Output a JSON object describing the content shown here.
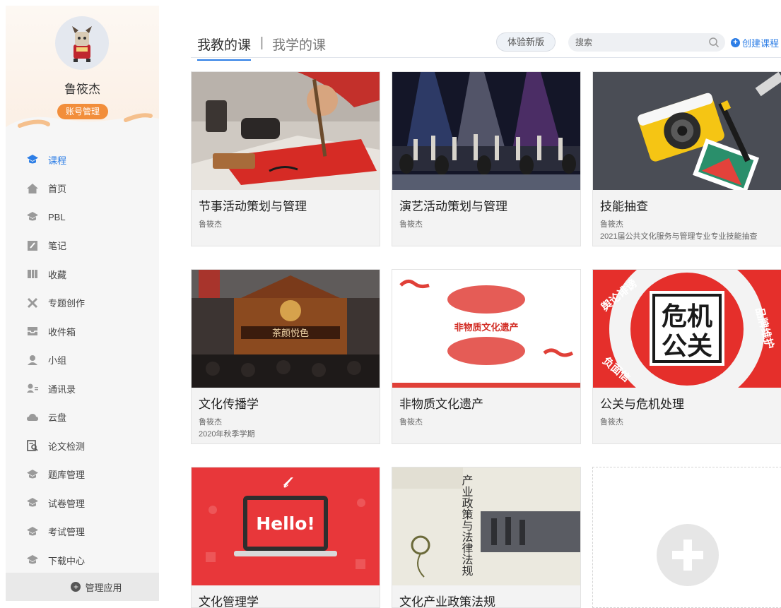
{
  "sidebar": {
    "user_name": "鲁筱杰",
    "account_button": "账号管理",
    "nav": [
      {
        "label": "课程",
        "icon": "course-icon",
        "active": true
      },
      {
        "label": "首页",
        "icon": "home-icon"
      },
      {
        "label": "PBL",
        "icon": "pbl-icon"
      },
      {
        "label": "笔记",
        "icon": "notes-icon"
      },
      {
        "label": "收藏",
        "icon": "favorites-icon"
      },
      {
        "label": "专题创作",
        "icon": "topic-create-icon"
      },
      {
        "label": "收件箱",
        "icon": "inbox-icon"
      },
      {
        "label": "小组",
        "icon": "group-icon"
      },
      {
        "label": "通讯录",
        "icon": "contacts-icon"
      },
      {
        "label": "云盘",
        "icon": "cloud-drive-icon"
      },
      {
        "label": "论文检测",
        "icon": "paper-check-icon"
      },
      {
        "label": "题库管理",
        "icon": "question-bank-icon"
      },
      {
        "label": "试卷管理",
        "icon": "exam-paper-icon"
      },
      {
        "label": "考试管理",
        "icon": "exam-manage-icon"
      },
      {
        "label": "下载中心",
        "icon": "download-center-icon"
      }
    ],
    "manage_apps": "管理应用"
  },
  "header": {
    "tab_teach": "我教的课",
    "separator": "|",
    "tab_learn": "我学的课",
    "new_version": "体验新版",
    "search_placeholder": "搜索",
    "create_course": "创建课程"
  },
  "courses": [
    {
      "title": "节事活动策划与管理",
      "teacher": "鲁筱杰",
      "sub": ""
    },
    {
      "title": "演艺活动策划与管理",
      "teacher": "鲁筱杰",
      "sub": ""
    },
    {
      "title": "技能抽查",
      "teacher": "鲁筱杰",
      "sub": "2021届公共文化服务与管理专业专业技能抽查"
    },
    {
      "title": "文化传播学",
      "teacher": "鲁筱杰",
      "sub": "2020年秋季学期"
    },
    {
      "title": "非物质文化遗产",
      "teacher": "鲁筱杰",
      "sub": ""
    },
    {
      "title": "公关与危机处理",
      "teacher": "鲁筱杰",
      "sub": ""
    },
    {
      "title": "文化管理学",
      "teacher": "",
      "sub": ""
    },
    {
      "title": "文化产业政策法规",
      "teacher": "",
      "sub": ""
    }
  ],
  "thumb_text": {
    "teahouse_sign": "茶颜悦色",
    "heritage_title": "非物质文化遗产",
    "crisis_line1": "危机",
    "crisis_line2": "公关",
    "crisis_ring_1": "品牌维护",
    "crisis_ring_2": "舆论诽谤",
    "crisis_ring_3": "负面信",
    "hello": "Hello!",
    "book_vertical": "产业政策与法律法规"
  },
  "colors": {
    "accent": "#2d7ee6",
    "account_button": "#f28e3b",
    "crisis_red": "#e52f2b"
  }
}
